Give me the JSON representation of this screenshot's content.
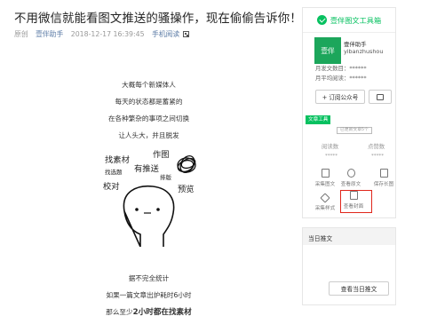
{
  "article": {
    "title": "不用微信就能看图文推送的骚操作，现在偷偷告诉你！",
    "meta": {
      "tag": "原创",
      "author": "壹伴助手",
      "datetime": "2018-12-17 16:39:45",
      "mobile_read": "手机阅读",
      "qr_icon": "qr-code-icon"
    },
    "para1": [
      "大概每个新媒体人",
      "每天的状态都是蓄紧的",
      "在各种繁杂的事项之间切换",
      "让人头大，并且脱发"
    ],
    "illustration": {
      "words": [
        "找素材",
        "作图",
        "有推送",
        "找选题",
        "排版",
        "校对",
        "预览"
      ]
    },
    "para2": {
      "line1": "据不完全统计",
      "line2": "如果一篇文章出炉耗时6小时",
      "line3_prefix": "那么至少",
      "line3_bold": "2小时都在找素材"
    }
  },
  "toolbox": {
    "header": "壹伴图文工具箱",
    "account": {
      "avatar_text": "壹伴",
      "name": "壹伴助手",
      "id": "yibanzhushou",
      "stat1": "月发文数目：******",
      "stat2": "月平均阅读：******"
    },
    "subscribe_label": "+ 订阅公众号",
    "tool_tag": "文章工具",
    "version_tag": "已更新文章5个",
    "metrics": [
      {
        "label": "阅读数",
        "value": "*****"
      },
      {
        "label": "点赞数",
        "value": "*****"
      }
    ],
    "tools": [
      "采集图文",
      "查看原文",
      "保存长图",
      "采集样式",
      "查看封面"
    ]
  },
  "today": {
    "header": "当日推文",
    "button": "查看当日推文"
  },
  "colors": {
    "brand_green": "#07c160",
    "highlight_red": "#e0261b"
  }
}
